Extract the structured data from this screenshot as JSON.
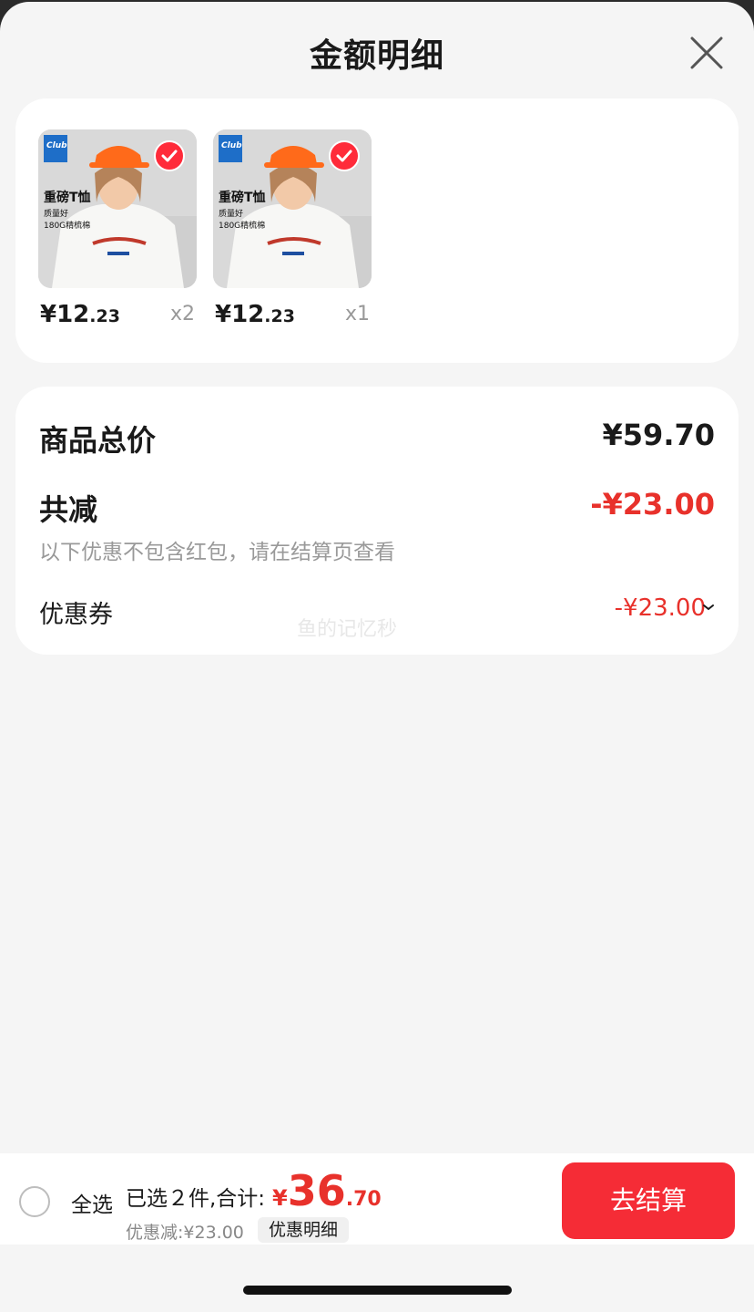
{
  "sheet": {
    "title": "金额明细"
  },
  "products": [
    {
      "thumb_title": "重磅T恤",
      "thumb_line1": "质量好",
      "thumb_line2": "180G精梳棉",
      "brand": "Club",
      "price_int": "¥12",
      "price_dec": ".23",
      "qty": "x2"
    },
    {
      "thumb_title": "重磅T恤",
      "thumb_line1": "质量好",
      "thumb_line2": "180G精梳棉",
      "brand": "Club",
      "price_int": "¥12",
      "price_dec": ".23",
      "qty": "x1"
    }
  ],
  "summary": {
    "total_label": "商品总价",
    "total_value": "¥59.70",
    "reduce_label": "共减",
    "reduce_value": "-¥23.00",
    "note": "以下优惠不包含红包，请在结算页查看",
    "coupon_label": "优惠券",
    "coupon_value": "-¥23.00"
  },
  "watermark": "鱼的记忆秒",
  "footer": {
    "select_all": "全选",
    "selected_text": "已选２件,合计:",
    "total_symbol": "¥",
    "total_int": "36",
    "total_dec": ".70",
    "discount_text": "优惠减:¥23.00",
    "detail_button": "优惠明细",
    "checkout_button": "去结算"
  },
  "colors": {
    "accent": "#e8312b",
    "button": "#f52c36",
    "check": "#ff2b3a"
  }
}
